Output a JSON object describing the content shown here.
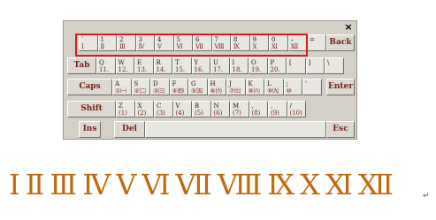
{
  "close_label": "×",
  "row1": [
    {
      "t": "`",
      "b": "Ⅰ"
    },
    {
      "t": "1",
      "b": "Ⅱ"
    },
    {
      "t": "2",
      "b": "Ⅲ"
    },
    {
      "t": "3",
      "b": "Ⅳ"
    },
    {
      "t": "4",
      "b": "Ⅴ"
    },
    {
      "t": "5",
      "b": "Ⅵ"
    },
    {
      "t": "6",
      "b": "Ⅶ"
    },
    {
      "t": "7",
      "b": "Ⅷ"
    },
    {
      "t": "8",
      "b": "Ⅸ"
    },
    {
      "t": "9",
      "b": "Ⅹ"
    },
    {
      "t": "0",
      "b": "Ⅺ"
    },
    {
      "t": "–",
      "b": "Ⅻ"
    },
    {
      "t": "=",
      "b": ""
    }
  ],
  "backspace_label": "Back",
  "tab_label": "Tab",
  "row2": [
    {
      "t": "Q",
      "b": "11."
    },
    {
      "t": "W",
      "b": "12."
    },
    {
      "t": "E",
      "b": "13."
    },
    {
      "t": "R",
      "b": "14."
    },
    {
      "t": "T",
      "b": "15."
    },
    {
      "t": "Y",
      "b": "16."
    },
    {
      "t": "U",
      "b": "17."
    },
    {
      "t": "I",
      "b": "18."
    },
    {
      "t": "O",
      "b": "19."
    },
    {
      "t": "P",
      "b": "20."
    },
    {
      "t": "[",
      "b": ""
    },
    {
      "t": "]",
      "b": ""
    },
    {
      "t": "\\",
      "b": ""
    }
  ],
  "caps_label": "Caps",
  "row3": [
    {
      "t": "A",
      "b": "①㈠"
    },
    {
      "t": "S",
      "b": "②㈡"
    },
    {
      "t": "D",
      "b": "③㈢"
    },
    {
      "t": "F",
      "b": "④㈣"
    },
    {
      "t": "G",
      "b": "⑤㈤"
    },
    {
      "t": "H",
      "b": "⑥㈥"
    },
    {
      "t": "J",
      "b": "⑦㈦"
    },
    {
      "t": "K",
      "b": "⑧㈧"
    },
    {
      "t": "L",
      "b": "⑨㈨"
    },
    {
      "t": ";",
      "b": "⑩"
    },
    {
      "t": "'",
      "b": ""
    }
  ],
  "enter_label": "Enter",
  "shift_label": "Shift",
  "row4": [
    {
      "t": "Z",
      "b": "(1)"
    },
    {
      "t": "X",
      "b": "(2)"
    },
    {
      "t": "C",
      "b": "(3)"
    },
    {
      "t": "V",
      "b": "(4)"
    },
    {
      "t": "B",
      "b": "(5)"
    },
    {
      "t": "N",
      "b": "(6)"
    },
    {
      "t": "M",
      "b": "(7)"
    },
    {
      "t": ",",
      "b": "(8)"
    },
    {
      "t": ".",
      "b": "(9)"
    },
    {
      "t": "/",
      "b": "(10)"
    }
  ],
  "ins_label": "Ins",
  "del_label": "Del",
  "esc_label": "Esc",
  "numerals": [
    "Ⅰ",
    "Ⅱ",
    "Ⅲ",
    "Ⅳ",
    "Ⅴ",
    "Ⅵ",
    "Ⅶ",
    "Ⅷ",
    "Ⅸ",
    "Ⅹ",
    "Ⅺ",
    "Ⅻ"
  ],
  "trailing_mark": "↵"
}
